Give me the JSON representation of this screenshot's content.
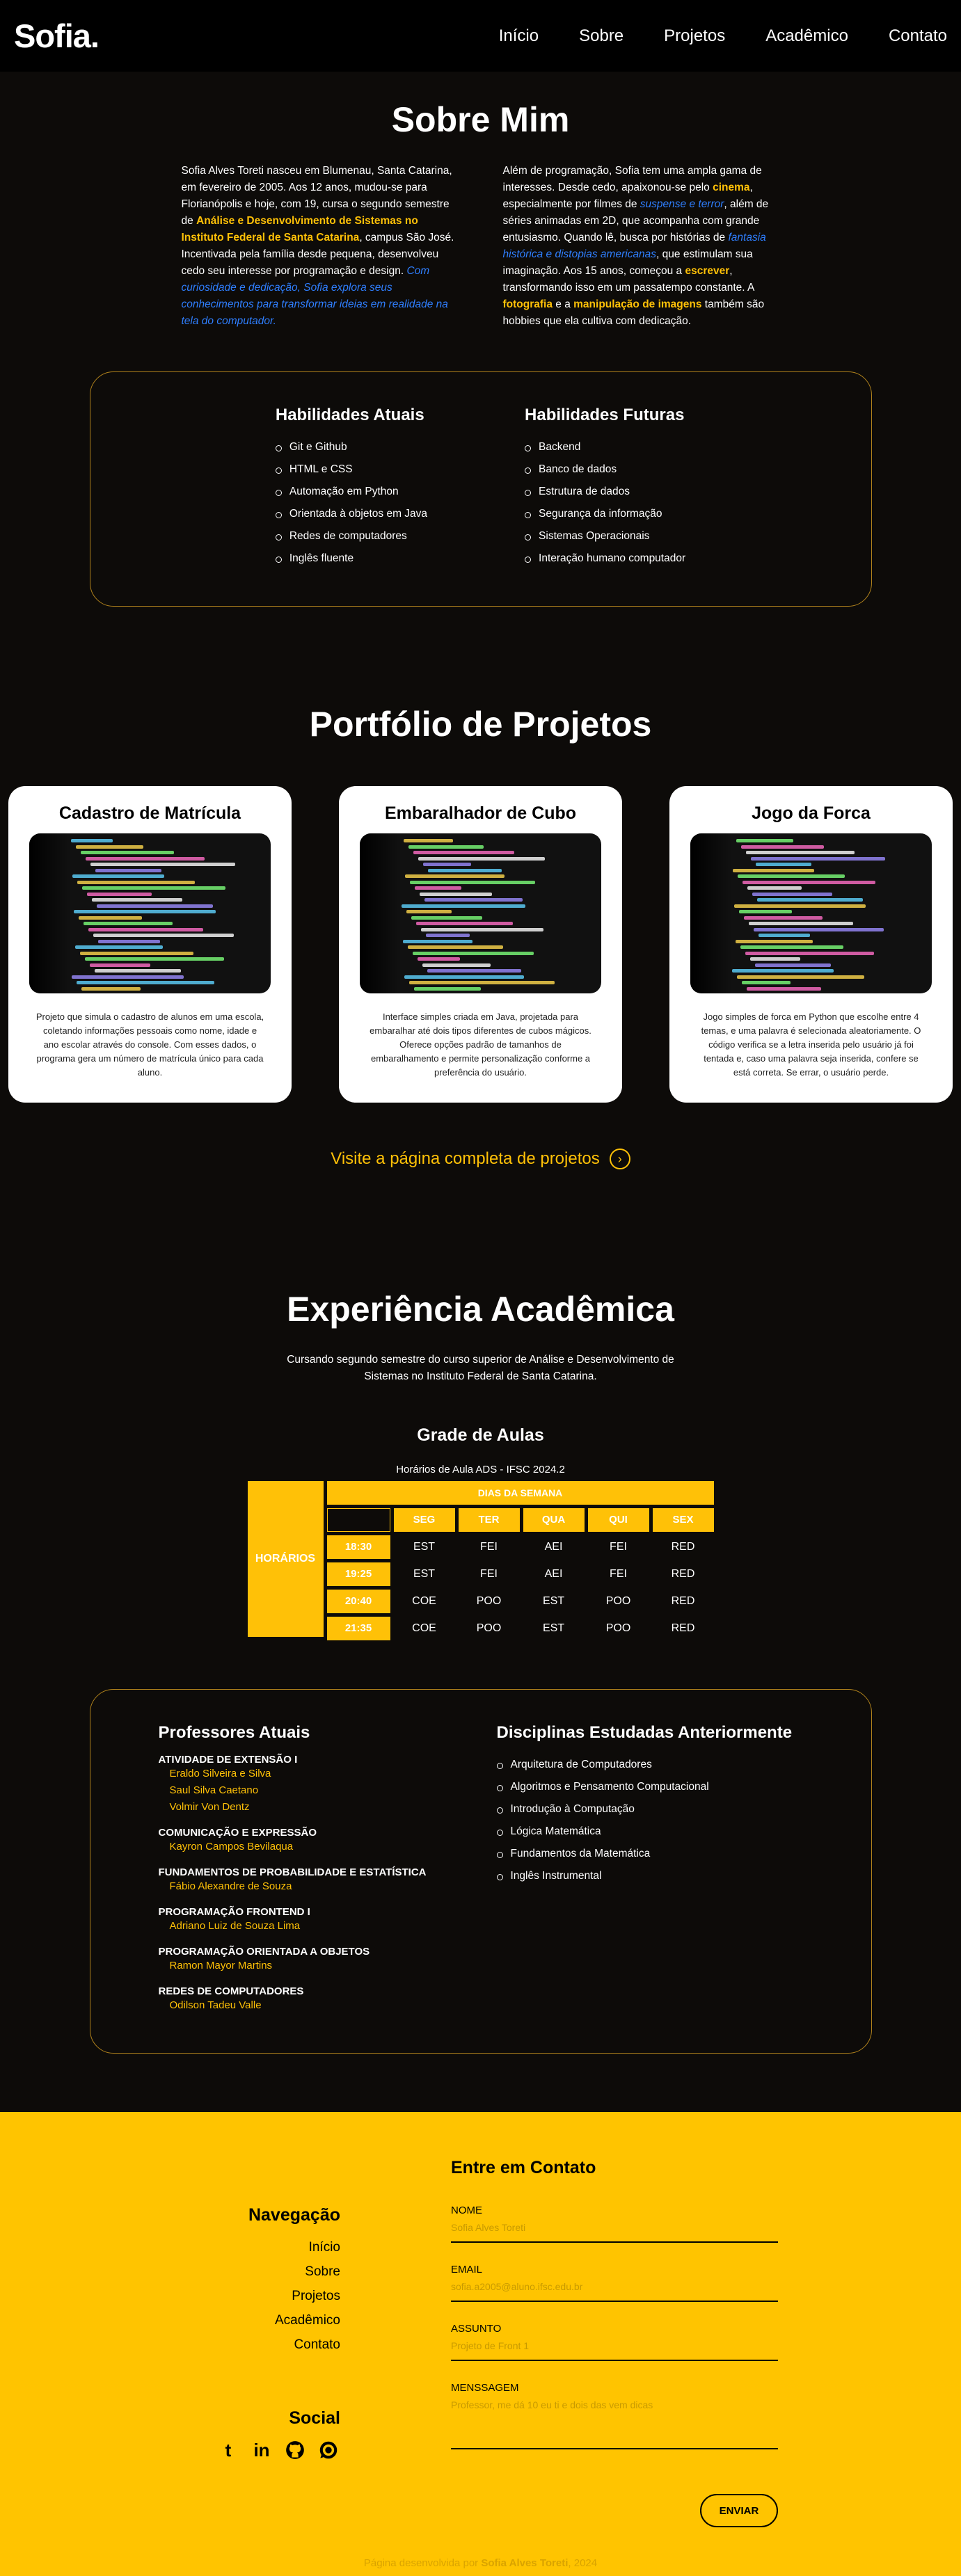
{
  "header": {
    "logo": "Sofia.",
    "nav": [
      "Início",
      "Sobre",
      "Projetos",
      "Acadêmico",
      "Contato"
    ]
  },
  "about": {
    "title": "Sobre Mim",
    "left": {
      "t1": "Sofia Alves Toreti nasceu em Blumenau, Santa Catarina, em fevereiro de 2005. Aos 12 anos, mudou-se para Florianópolis e hoje, com 19, cursa o segundo semestre de ",
      "h1": "Análise e Desenvolvimento de Sistemas no Instituto Federal de Santa Catarina",
      "t2": ", campus São José. Incentivada pela família desde pequena, desenvolveu cedo seu interesse por programação e design. ",
      "i1": "Com curiosidade e dedicação, Sofia explora seus conhecimentos para transformar ideias em realidade na tela do computador."
    },
    "right": {
      "t1": "Além de programação, Sofia tem uma ampla gama de interesses. Desde cedo, apaixonou-se pelo ",
      "h1": "cinema",
      "t2": ", especialmente por filmes de ",
      "i1": "suspense e terror",
      "t3": ", além de séries animadas em 2D, que acompanha com grande entusiasmo. Quando lê, busca por histórias de ",
      "i2": "fantasia histórica e distopias americanas",
      "t4": ", que estimulam sua imaginação. Aos 15 anos, começou a ",
      "h2": "escrever",
      "t5": ", transformando isso em um passatempo constante. A ",
      "h3": "fotografia",
      "t6": " e a ",
      "h4": "manipulação de imagens",
      "t7": " também são hobbies que ela cultiva com dedicação."
    },
    "skills_now": {
      "title": "Habilidades Atuais",
      "items": [
        "Git e Github",
        "HTML e CSS",
        "Automação em Python",
        "Orientada à objetos em Java",
        "Redes de computadores",
        "Inglês fluente"
      ]
    },
    "skills_future": {
      "title": "Habilidades Futuras",
      "items": [
        "Backend",
        "Banco de dados",
        "Estrutura de dados",
        "Segurança da informação",
        "Sistemas Operacionais",
        "Interação humano computador"
      ]
    }
  },
  "portfolio": {
    "title": "Portfólio de Projetos",
    "cards": [
      {
        "title": "Cadastro de Matrícula",
        "desc": "Projeto que simula o cadastro de alunos em uma escola, coletando informações pessoais como nome, idade e ano escolar através do console. Com esses dados, o programa gera um número de matrícula único para cada aluno."
      },
      {
        "title": "Embaralhador de Cubo",
        "desc": "Interface simples criada em Java, projetada para embaralhar até dois tipos diferentes de cubos mágicos. Oferece opções padrão de tamanhos de embaralhamento e permite personalização conforme a preferência do usuário."
      },
      {
        "title": "Jogo da Forca",
        "desc": "Jogo simples de forca em Python que escolhe entre 4 temas, e uma palavra é selecionada aleatoriamente. O código verifica se a letra inserida pelo usuário já foi tentada e, caso uma palavra seja inserida, confere se está correta. Se errar, o usuário perde."
      }
    ],
    "visit": "Visite a página completa de projetos"
  },
  "academic": {
    "title": "Experiência Acadêmica",
    "intro": "Cursando segundo semestre do curso superior de Análise e Desenvolvimento de Sistemas no Instituto Federal de Santa Catarina.",
    "grade_title": "Grade de Aulas",
    "caption": "Horários de Aula ADS - IFSC 2024.2",
    "horarios": "HORÁRIOS",
    "dias": "DIAS DA SEMANA",
    "days": [
      "SEG",
      "TER",
      "QUA",
      "QUI",
      "SEX"
    ],
    "rows": [
      {
        "time": "18:30",
        "cells": [
          "EST",
          "FEI",
          "AEI",
          "FEI",
          "RED"
        ]
      },
      {
        "time": "19:25",
        "cells": [
          "EST",
          "FEI",
          "AEI",
          "FEI",
          "RED"
        ]
      },
      {
        "time": "20:40",
        "cells": [
          "COE",
          "POO",
          "EST",
          "POO",
          "RED"
        ]
      },
      {
        "time": "21:35",
        "cells": [
          "COE",
          "POO",
          "EST",
          "POO",
          "RED"
        ]
      }
    ],
    "professors": {
      "title": "Professores Atuais",
      "groups": [
        {
          "subject": "ATIVIDADE DE EXTENSÃO I",
          "teachers": [
            "Eraldo Silveira e Silva",
            "Saul Silva Caetano",
            "Volmir Von Dentz"
          ]
        },
        {
          "subject": "COMUNICAÇÃO E EXPRESSÃO",
          "teachers": [
            "Kayron Campos Bevilaqua"
          ]
        },
        {
          "subject": "FUNDAMENTOS DE PROBABILIDADE E ESTATÍSTICA",
          "teachers": [
            "Fábio Alexandre de Souza"
          ]
        },
        {
          "subject": "PROGRAMAÇÃO FRONTEND I",
          "teachers": [
            "Adriano Luiz de Souza Lima"
          ]
        },
        {
          "subject": "PROGRAMAÇÃO ORIENTADA A OBJETOS",
          "teachers": [
            "Ramon Mayor Martins"
          ]
        },
        {
          "subject": "REDES DE COMPUTADORES",
          "teachers": [
            "Odilson Tadeu Valle"
          ]
        }
      ]
    },
    "previous": {
      "title": "Disciplinas Estudadas Anteriormente",
      "items": [
        "Arquitetura de Computadores",
        "Algoritmos e Pensamento Computacional",
        "Introdução à Computação",
        "Lógica Matemática",
        "Fundamentos da Matemática",
        "Inglês Instrumental"
      ]
    }
  },
  "footer": {
    "nav_title": "Navegação",
    "nav": [
      "Início",
      "Sobre",
      "Projetos",
      "Acadêmico",
      "Contato"
    ],
    "social_title": "Social",
    "social_icons": [
      "tumblr-icon",
      "linkedin-icon",
      "github-icon",
      "whatsapp-icon"
    ],
    "contact_title": "Entre em Contato",
    "fields": [
      {
        "label": "NOME",
        "placeholder": "Sofia Alves Toreti"
      },
      {
        "label": "EMAIL",
        "placeholder": "sofia.a2005@aluno.ifsc.edu.br"
      },
      {
        "label": "ASSUNTO",
        "placeholder": "Projeto de Front 1"
      },
      {
        "label": "MENSSAGEM",
        "placeholder": "Professor, me dá 10 eu ti e dois das vem dicas"
      }
    ],
    "send": "ENVIAR",
    "credits_prefix": "Página desenvolvida por ",
    "credits_name": "Sofia Alves Toreti",
    "credits_suffix": ", 2024"
  }
}
